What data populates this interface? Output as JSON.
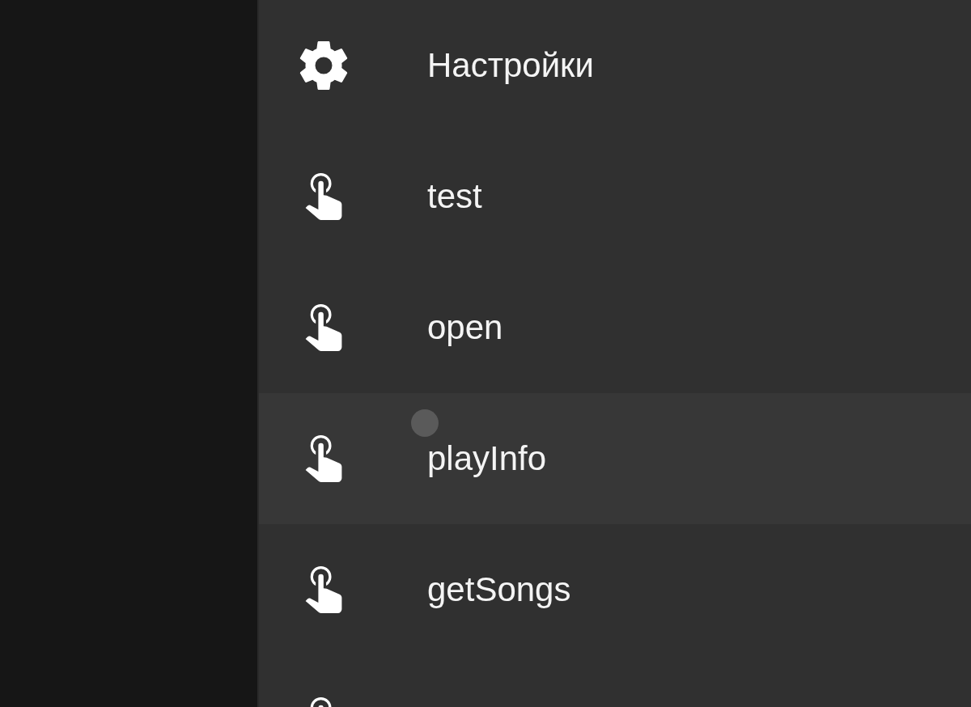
{
  "drawer": {
    "items": [
      {
        "kind": "settings",
        "label": "Настройки",
        "selected": false
      },
      {
        "kind": "action",
        "label": "test",
        "selected": false
      },
      {
        "kind": "action",
        "label": "open",
        "selected": false
      },
      {
        "kind": "action",
        "label": "playInfo",
        "selected": true
      },
      {
        "kind": "action",
        "label": "getSongs",
        "selected": false
      },
      {
        "kind": "action",
        "selected": false
      }
    ]
  }
}
